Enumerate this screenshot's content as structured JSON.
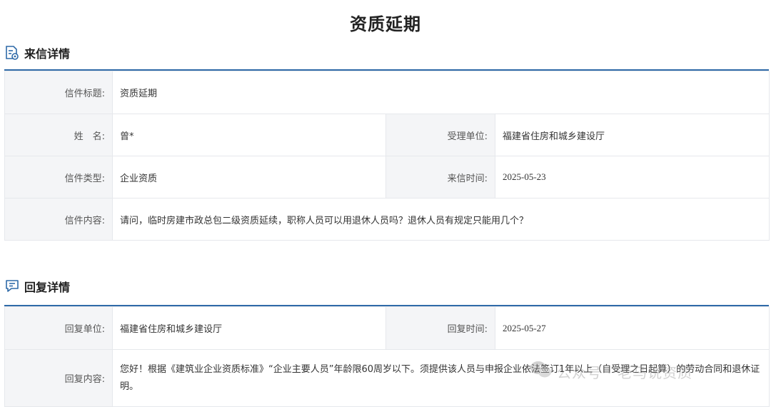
{
  "page": {
    "title": "资质延期"
  },
  "letter_section": {
    "heading": "来信详情",
    "icon": "document-eye-icon",
    "rows": {
      "title_label": "信件标题:",
      "title_value": "资质延期",
      "name_label": "姓　名:",
      "name_value": "曾*",
      "dept_label": "受理单位:",
      "dept_value": "福建省住房和城乡建设厅",
      "type_label": "信件类型:",
      "type_value": "企业资质",
      "time_label": "来信时间:",
      "time_value": "2025-05-23",
      "content_label": "信件内容:",
      "content_value": "请问，临时房建市政总包二级资质延续，职称人员可以用退休人员吗？退休人员有规定只能用几个？"
    }
  },
  "reply_section": {
    "heading": "回复详情",
    "icon": "chat-bubble-icon",
    "rows": {
      "unit_label": "回复单位:",
      "unit_value": "福建省住房和城乡建设厅",
      "time_label": "回复时间:",
      "time_value": "2025-05-27",
      "content_label": "回复内容:",
      "content_value": "您好！根据《建筑业企业资质标准》“企业主要人员”年龄限60周岁以下。须提供该人员与申报企业依法签订1年以上（自受理之日起算）的劳动合同和退休证明。"
    }
  },
  "watermark": {
    "text": "公众号 · 老马说资质",
    "icon": "wechat-logo-icon"
  },
  "colors": {
    "accent": "#2f6aa8",
    "label_bg": "#f4f5f7",
    "border": "#e6e8ec"
  }
}
